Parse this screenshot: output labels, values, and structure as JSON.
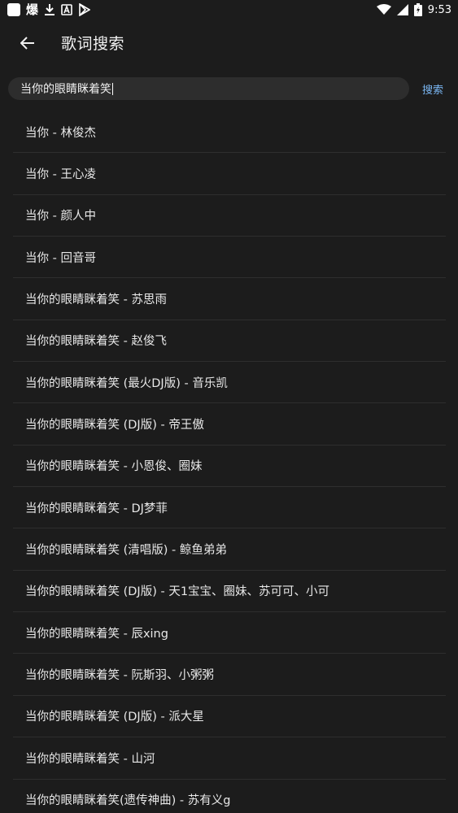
{
  "status_bar": {
    "time": "9:53",
    "left_icons": [
      "app-square-icon",
      "bao-text-icon",
      "download-icon",
      "a-box-icon",
      "play-store-icon"
    ],
    "right_icons": [
      "wifi-icon",
      "signal-icon",
      "battery-charging-icon"
    ],
    "bao_glyph": "爆"
  },
  "header": {
    "title": "歌词搜索"
  },
  "search": {
    "query": "当你的眼睛眯着笑",
    "button_label": "搜索"
  },
  "results": [
    {
      "label": "当你 - 林俊杰"
    },
    {
      "label": "当你 - 王心凌"
    },
    {
      "label": "当你 - 颜人中"
    },
    {
      "label": "当你 - 回音哥"
    },
    {
      "label": "当你的眼睛眯着笑 - 苏思雨"
    },
    {
      "label": "当你的眼睛眯着笑 - 赵俊飞"
    },
    {
      "label": "当你的眼睛眯着笑 (最火DJ版) - 音乐凯"
    },
    {
      "label": "当你的眼睛眯着笑 (DJ版) - 帝王傲"
    },
    {
      "label": "当你的眼睛眯着笑 - 小恩俊、圈妹"
    },
    {
      "label": "当你的眼睛眯着笑 - DJ梦菲"
    },
    {
      "label": "当你的眼睛眯着笑 (清唱版) - 鲸鱼弟弟"
    },
    {
      "label": "当你的眼睛眯着笑 (DJ版) - 天1宝宝、圈妹、苏可可、小可"
    },
    {
      "label": "当你的眼睛眯着笑 - 辰xing"
    },
    {
      "label": "当你的眼睛眯着笑 - 阮斯羽、小粥粥"
    },
    {
      "label": "当你的眼睛眯着笑 (DJ版) - 派大星"
    },
    {
      "label": "当你的眼睛眯着笑 - 山河"
    },
    {
      "label": "当你的眼睛眯着笑(遗传神曲) - 苏有义g"
    }
  ],
  "colors": {
    "background": "#1c1c1c",
    "search_field": "#2d2d2d",
    "accent": "#7ab6f2",
    "divider": "#2e2e2e"
  }
}
